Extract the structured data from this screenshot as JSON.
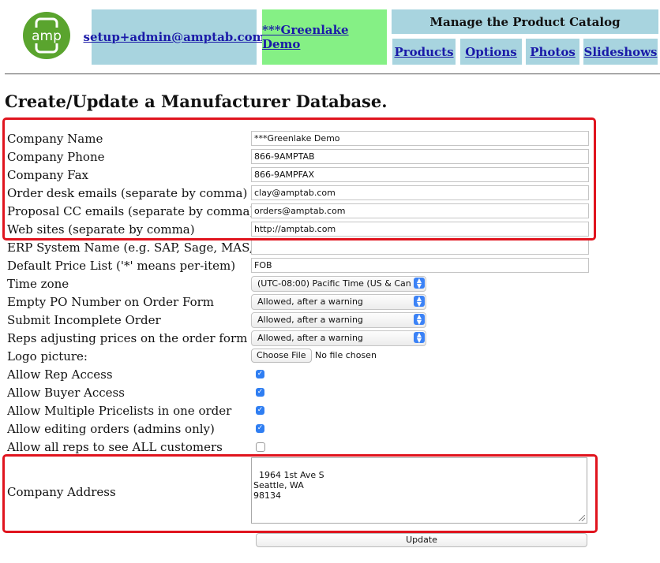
{
  "header": {
    "user_email": "setup+admin@amptab.com",
    "company_link": "***Greenlake Demo",
    "catalog_title": "Manage the Product Catalog",
    "nav": [
      "Products",
      "Options",
      "Photos",
      "Slideshows"
    ],
    "logo_text": "amp"
  },
  "page_title": "Create/Update a Manufacturer Database.",
  "fields": {
    "company_name": {
      "label": "Company Name",
      "value": "***Greenlake Demo"
    },
    "company_phone": {
      "label": "Company Phone",
      "value": "866-9AMPTAB"
    },
    "company_fax": {
      "label": "Company Fax",
      "value": "866-9AMPFAX"
    },
    "order_desk_emails": {
      "label": "Order desk emails (separate by comma)",
      "value": "clay@amptab.com"
    },
    "proposal_cc_emails": {
      "label": "Proposal CC emails (separate by comma)",
      "value": "orders@amptab.com"
    },
    "web_sites": {
      "label": "Web sites (separate by comma)",
      "value": "http://amptab.com"
    },
    "erp_system": {
      "label": "ERP System Name (e.g. SAP, Sage, MAS, etc.)",
      "value": ""
    },
    "default_price_list": {
      "label": "Default Price List ('*' means per-item)",
      "value": "FOB"
    },
    "time_zone": {
      "label": "Time zone",
      "value": "(UTC-08:00) Pacific Time (US & Can"
    },
    "empty_po": {
      "label": "Empty PO Number on Order Form",
      "value": "Allowed, after a warning"
    },
    "submit_incomplete": {
      "label": "Submit Incomplete Order",
      "value": "Allowed, after a warning"
    },
    "reps_adjust_prices": {
      "label": "Reps adjusting prices on the order form",
      "value": "Allowed, after a warning"
    },
    "logo_picture": {
      "label": "Logo picture:",
      "button": "Choose File",
      "status": "No file chosen"
    },
    "allow_rep_access": {
      "label": "Allow Rep Access",
      "checked": true
    },
    "allow_buyer_access": {
      "label": "Allow Buyer Access",
      "checked": true
    },
    "allow_multiple_pricelists": {
      "label": "Allow Multiple Pricelists in one order",
      "checked": true
    },
    "allow_editing_orders": {
      "label": "Allow editing orders (admins only)",
      "checked": true
    },
    "allow_all_reps": {
      "label": "Allow all reps to see ALL customers",
      "checked": false
    },
    "company_address": {
      "label": "Company Address",
      "value": "1964 1st Ave S\nSeattle, WA\n98134"
    }
  },
  "update_button": "Update",
  "colors": {
    "nav_bg": "#a8d4df",
    "company_bg": "#85f085",
    "logo_green": "#5aa42e",
    "highlight_red": "#e0141e",
    "checkbox_blue": "#2f7ef2"
  }
}
